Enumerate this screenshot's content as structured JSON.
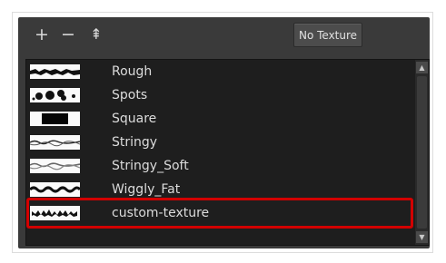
{
  "toolbar": {
    "add_label": "+",
    "remove_label": "−",
    "import_label": "⇞",
    "no_texture_label": "No Texture"
  },
  "textures": [
    {
      "name": "Rough",
      "icon": "rough-texture-icon"
    },
    {
      "name": "Spots",
      "icon": "spots-texture-icon"
    },
    {
      "name": "Square",
      "icon": "square-texture-icon"
    },
    {
      "name": "Stringy",
      "icon": "stringy-texture-icon"
    },
    {
      "name": "Stringy_Soft",
      "icon": "stringy-soft-texture-icon"
    },
    {
      "name": "Wiggly_Fat",
      "icon": "wiggly-fat-texture-icon"
    },
    {
      "name": "custom-texture",
      "icon": "custom-texture-icon"
    }
  ],
  "scrollbar": {
    "up": "▲",
    "down": "▼"
  },
  "colors": {
    "highlight": "#d20000",
    "panel": "#3a3a3a",
    "list": "#1e1e1e"
  }
}
